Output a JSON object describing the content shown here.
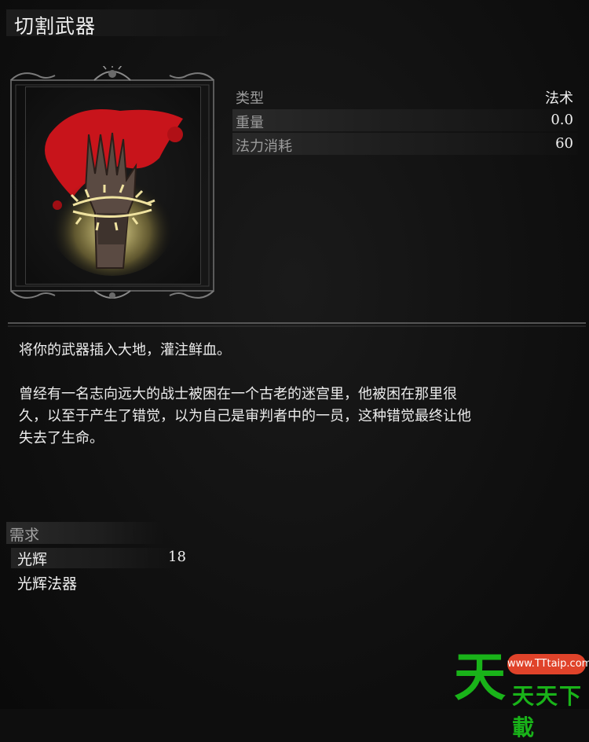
{
  "item": {
    "title": "切割武器",
    "icon": "bloody-gauntlet-with-thorn-wrap-icon"
  },
  "stats": [
    {
      "label": "类型",
      "value": "法术"
    },
    {
      "label": "重量",
      "value": "0.0"
    },
    {
      "label": "法力消耗",
      "value": "60"
    }
  ],
  "description": {
    "line1": "将你的武器插入大地，灌注鲜血。",
    "lore_lines": [
      "曾经有一名志向远大的战士被困在一个古老的迷宫里，他被困在那里很",
      "久，以至于产生了错觉，以为自己是审判者中的一员，这种错觉最终让他",
      "失去了生命。"
    ]
  },
  "requirements": {
    "title": "需求",
    "items": [
      {
        "label": "光辉",
        "value": "18"
      },
      {
        "label": "光辉法器",
        "value": ""
      }
    ]
  },
  "watermark": {
    "big": "天",
    "pill": "www.TTtaip.com",
    "small": "天天下載"
  },
  "colors": {
    "blood": "#c8141b",
    "thorn": "#e8d98a",
    "watermark_green": "#19b319",
    "watermark_red": "#e0432a"
  }
}
